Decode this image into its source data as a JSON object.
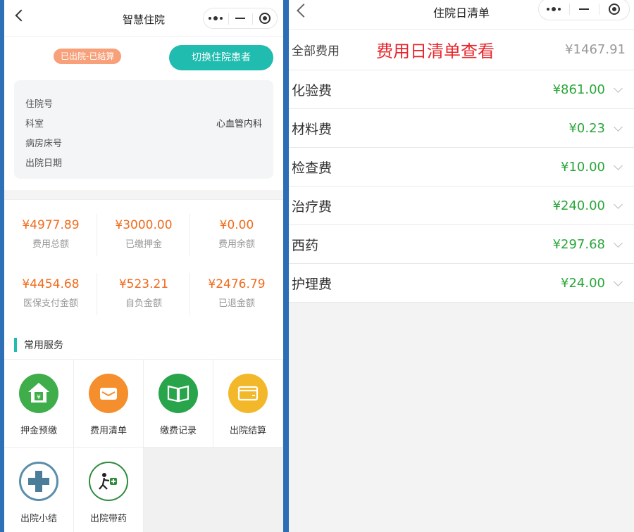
{
  "left": {
    "nav_title": "智慧住院",
    "patient_name": "       ",
    "status_badge": "已出院-已结算",
    "switch_button": "切换住院患者",
    "info": [
      {
        "label": "住院号",
        "value": ""
      },
      {
        "label": "科室",
        "value": "心血管内科"
      },
      {
        "label": "病房床号",
        "value": ""
      },
      {
        "label": "出院日期",
        "value": ""
      }
    ],
    "fees": [
      {
        "amount": "¥4977.89",
        "label": "费用总额"
      },
      {
        "amount": "¥3000.00",
        "label": "已缴押金"
      },
      {
        "amount": "¥0.00",
        "label": "费用余额"
      },
      {
        "amount": "¥4454.68",
        "label": "医保支付金额"
      },
      {
        "amount": "¥523.21",
        "label": "自负金额"
      },
      {
        "amount": "¥2476.79",
        "label": "已退金额"
      }
    ],
    "services_title": "常用服务",
    "services": [
      {
        "label": "押金预缴",
        "icon": "house-yuan-icon"
      },
      {
        "label": "费用清单",
        "icon": "envelope-icon"
      },
      {
        "label": "缴费记录",
        "icon": "book-icon"
      },
      {
        "label": "出院结算",
        "icon": "card-icon"
      },
      {
        "label": "出院小结",
        "icon": "plus-cross-icon"
      },
      {
        "label": "出院带药",
        "icon": "person-medicine-icon"
      }
    ]
  },
  "right": {
    "nav_title": "住院日清单",
    "total_label": "全部费用",
    "overlay_text": "费用日清单查看",
    "total_amount": "¥1467.91",
    "items": [
      {
        "label": "化验费",
        "amount": "¥861.00"
      },
      {
        "label": "材料费",
        "amount": "¥0.23"
      },
      {
        "label": "检查费",
        "amount": "¥10.00"
      },
      {
        "label": "治疗费",
        "amount": "¥240.00"
      },
      {
        "label": "西药",
        "amount": "¥297.68"
      },
      {
        "label": "护理费",
        "amount": "¥24.00"
      }
    ]
  },
  "colors": {
    "accent": "#1fbcaf",
    "amount_orange": "#f06b1c",
    "amount_green": "#2aa63a",
    "overlay_red": "#e8232a"
  }
}
